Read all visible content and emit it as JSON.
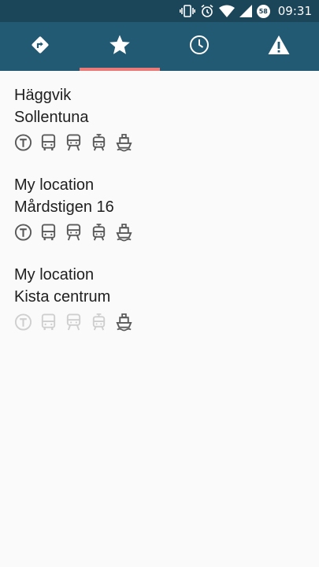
{
  "status_bar": {
    "time": "09:31",
    "battery_level": "58",
    "icons": [
      "vibrate-icon",
      "alarm-icon",
      "wifi-icon",
      "signal-icon",
      "battery-icon"
    ]
  },
  "tabs": [
    {
      "name": "directions",
      "icon": "directions-icon",
      "active": false
    },
    {
      "name": "favorites",
      "icon": "star-icon",
      "active": true
    },
    {
      "name": "history",
      "icon": "clock-icon",
      "active": false
    },
    {
      "name": "deviations",
      "icon": "warning-icon",
      "active": false
    }
  ],
  "colors": {
    "status_bar": "#1b4559",
    "tab_bar": "#235a73",
    "active_indicator": "#ec7a78",
    "mode_enabled": "#5a5a5a",
    "mode_disabled": "#cfcfcf"
  },
  "routes": [
    {
      "from": "Häggvik",
      "to": "Sollentuna",
      "modes": [
        {
          "icon": "metro-icon",
          "enabled": true
        },
        {
          "icon": "bus-icon",
          "enabled": true
        },
        {
          "icon": "train-icon",
          "enabled": true
        },
        {
          "icon": "tram-icon",
          "enabled": true
        },
        {
          "icon": "boat-icon",
          "enabled": true
        }
      ]
    },
    {
      "from": "My location",
      "to": "Mårdstigen 16",
      "modes": [
        {
          "icon": "metro-icon",
          "enabled": true
        },
        {
          "icon": "bus-icon",
          "enabled": true
        },
        {
          "icon": "train-icon",
          "enabled": true
        },
        {
          "icon": "tram-icon",
          "enabled": true
        },
        {
          "icon": "boat-icon",
          "enabled": true
        }
      ]
    },
    {
      "from": "My location",
      "to": "Kista centrum",
      "modes": [
        {
          "icon": "metro-icon",
          "enabled": false
        },
        {
          "icon": "bus-icon",
          "enabled": false
        },
        {
          "icon": "train-icon",
          "enabled": false
        },
        {
          "icon": "tram-icon",
          "enabled": false
        },
        {
          "icon": "boat-icon",
          "enabled": true
        }
      ]
    }
  ]
}
